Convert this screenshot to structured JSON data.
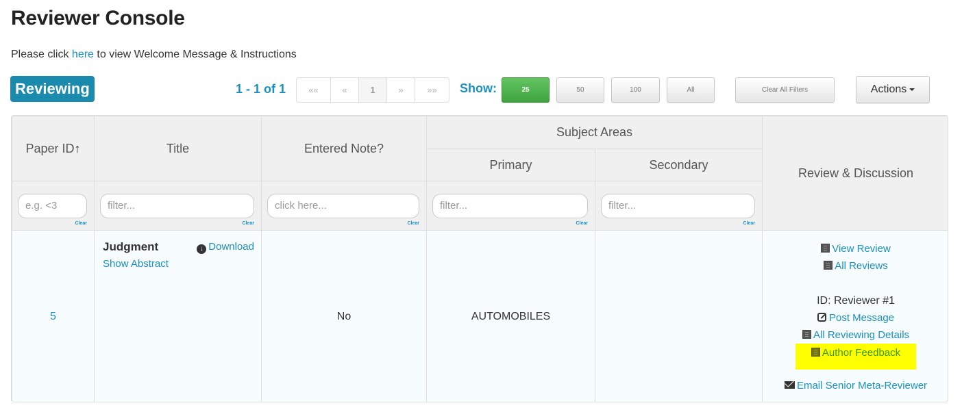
{
  "header": {
    "title": "Reviewer Console",
    "intro_prefix": "Please click ",
    "intro_link": "here",
    "intro_suffix": " to view Welcome Message & Instructions"
  },
  "toolbar": {
    "role_badge": "Reviewing",
    "range_text": "1 - 1 of 1",
    "pager": [
      {
        "label": "««",
        "name": "first"
      },
      {
        "label": "«",
        "name": "prev"
      },
      {
        "label": "1",
        "name": "page-1",
        "active": true
      },
      {
        "label": "»",
        "name": "next"
      },
      {
        "label": "»»",
        "name": "last"
      }
    ],
    "show_label": "Show:",
    "page_sizes": [
      "25",
      "50",
      "100",
      "All"
    ],
    "selected_page_size": "25",
    "clear_filters_label": "Clear All Filters",
    "actions_label": "Actions"
  },
  "table": {
    "headers": {
      "paper_id": "Paper ID",
      "paper_id_sort": "↑",
      "title": "Title",
      "entered_note": "Entered Note?",
      "subject_areas": "Subject Areas",
      "primary": "Primary",
      "secondary": "Secondary",
      "review_discussion": "Review & Discussion"
    },
    "filters": {
      "paper_id_placeholder": "e.g. <3",
      "title_placeholder": "filter...",
      "note_placeholder": "click here...",
      "primary_placeholder": "filter...",
      "secondary_placeholder": "filter...",
      "clear_label": "Clear"
    },
    "rows": [
      {
        "paper_id": "5",
        "title": "Judgment",
        "download_label": "Download",
        "show_abstract_label": "Show Abstract",
        "entered_note": "No",
        "primary": "AUTOMOBILES",
        "secondary": "",
        "review": {
          "view_review": "View Review",
          "all_reviews": "All Reviews",
          "reviewer_id": "ID: Reviewer #1",
          "post_message": "Post Message",
          "all_reviewing_details": "All Reviewing Details",
          "author_feedback": "Author Feedback",
          "email_meta_reviewer": "Email Senior Meta-Reviewer"
        }
      }
    ]
  },
  "colors": {
    "accent": "#1a8fc0",
    "badge": "#1a8aad",
    "active_green": "#4cb04c",
    "highlight": "#ffff00"
  }
}
